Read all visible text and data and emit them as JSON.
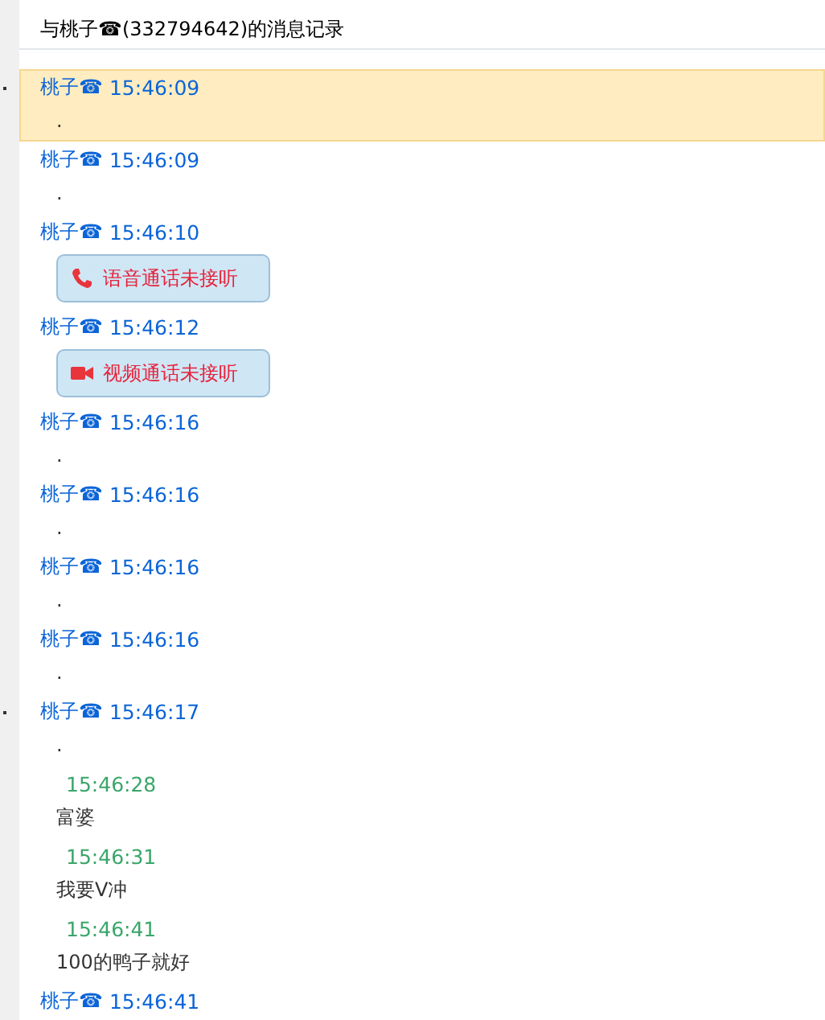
{
  "title": "与桃子☎(332794642)的消息记录",
  "messages": [
    {
      "outgoing": false,
      "sender": "桃子☎",
      "time": "15:46:09",
      "selected": true,
      "marker": true,
      "kind": "text",
      "body": "."
    },
    {
      "outgoing": false,
      "sender": "桃子☎",
      "time": "15:46:09",
      "selected": false,
      "marker": false,
      "kind": "text",
      "body": "."
    },
    {
      "outgoing": false,
      "sender": "桃子☎",
      "time": "15:46:10",
      "selected": false,
      "marker": false,
      "kind": "voice-call",
      "body": "语音通话未接听"
    },
    {
      "outgoing": false,
      "sender": "桃子☎",
      "time": "15:46:12",
      "selected": false,
      "marker": false,
      "kind": "video-call",
      "body": "视频通话未接听"
    },
    {
      "outgoing": false,
      "sender": "桃子☎",
      "time": "15:46:16",
      "selected": false,
      "marker": false,
      "kind": "text",
      "body": "."
    },
    {
      "outgoing": false,
      "sender": "桃子☎",
      "time": "15:46:16",
      "selected": false,
      "marker": false,
      "kind": "text",
      "body": "."
    },
    {
      "outgoing": false,
      "sender": "桃子☎",
      "time": "15:46:16",
      "selected": false,
      "marker": false,
      "kind": "text",
      "body": "."
    },
    {
      "outgoing": false,
      "sender": "桃子☎",
      "time": "15:46:16",
      "selected": false,
      "marker": false,
      "kind": "text",
      "body": "."
    },
    {
      "outgoing": false,
      "sender": "桃子☎",
      "time": "15:46:17",
      "selected": false,
      "marker": true,
      "kind": "text",
      "body": "."
    },
    {
      "outgoing": true,
      "time": "15:46:28",
      "selected": false,
      "marker": false,
      "kind": "text",
      "body": "富婆"
    },
    {
      "outgoing": true,
      "time": "15:46:31",
      "selected": false,
      "marker": false,
      "kind": "text",
      "body": "我要V冲"
    },
    {
      "outgoing": true,
      "time": "15:46:41",
      "selected": false,
      "marker": false,
      "kind": "text",
      "body": "100的鸭子就好"
    },
    {
      "outgoing": false,
      "sender": "桃子☎",
      "time": "15:46:41",
      "selected": false,
      "marker": false,
      "kind": "none"
    }
  ]
}
